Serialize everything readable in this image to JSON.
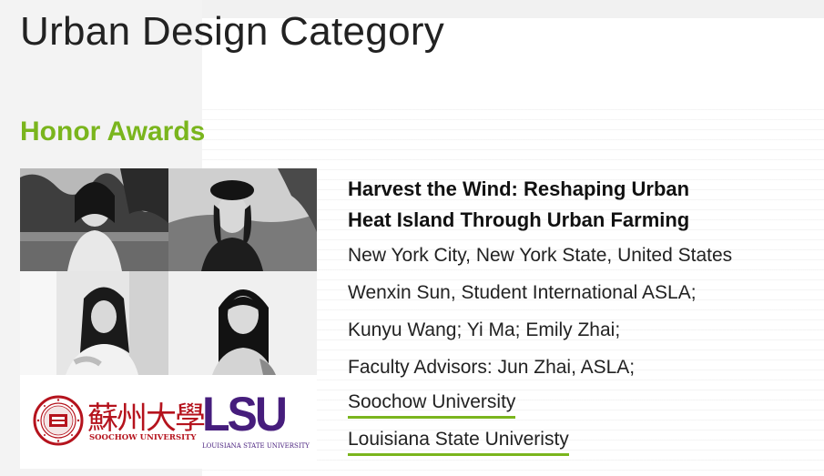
{
  "page": {
    "title": "Urban Design Category",
    "section_heading": "Honor Awards"
  },
  "award": {
    "project_title_line1": "Harvest the Wind: Reshaping Urban",
    "project_title_line2": "Heat Island Through Urban Farming",
    "location": "New York City, New York State, United States",
    "team_line1": "Wenxin Sun, Student International ASLA;",
    "team_line2": "Kunyu Wang; Yi Ma; Emily Zhai;",
    "advisors": "Faculty Advisors: Jun Zhai, ASLA;",
    "links": [
      {
        "label": "Soochow University"
      },
      {
        "label": "Louisiana State Univeristy"
      }
    ]
  },
  "logos": {
    "soochow_cn": "蘇州大學",
    "soochow_en": "SOOCHOW UNIVERSITY",
    "lsu_letters": "LSU",
    "lsu_sub": "LOUISIANA STATE UNIVERSITY"
  },
  "colors": {
    "accent_green": "#7ab51d",
    "soochow_red": "#b5131d",
    "lsu_purple": "#461d7c"
  }
}
